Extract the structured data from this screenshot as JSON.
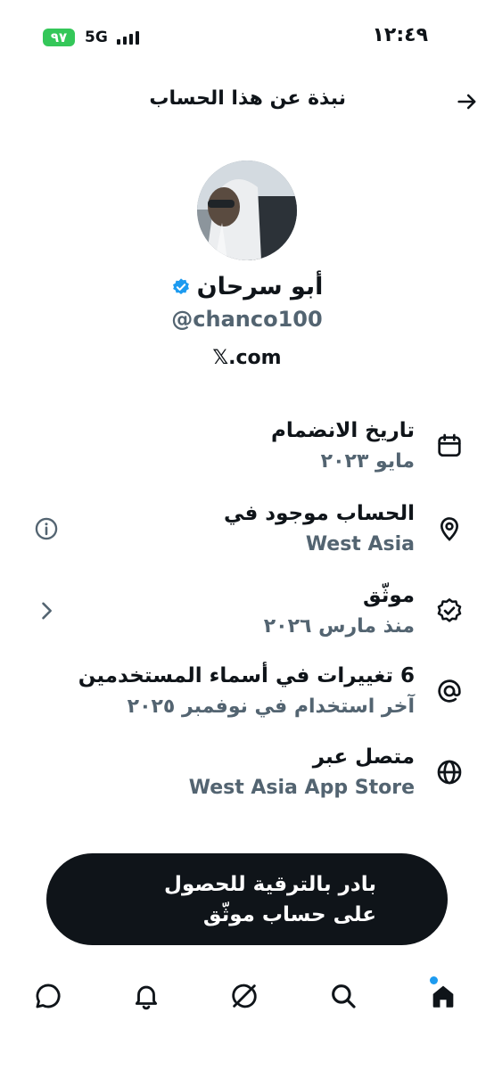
{
  "status_bar": {
    "time": "١٢:٤٩",
    "network": "5G",
    "battery": "٩٧"
  },
  "header": {
    "title": "نبذة عن هذا الحساب"
  },
  "profile": {
    "display_name": "أبو سرحان",
    "handle": "@chanco100",
    "website": "𝕏.com"
  },
  "info": [
    {
      "label": "تاريخ الانضمام",
      "value": "مايو ٢٠٢٣",
      "icon": "calendar-icon"
    },
    {
      "label": "الحساب موجود في",
      "value": "West Asia",
      "icon": "location-pin-icon"
    },
    {
      "label": "موثّق",
      "value": "منذ مارس ٢٠٢٦",
      "icon": "verified-outline-icon"
    },
    {
      "label": "6 تغييرات في أسماء المستخدمين",
      "value": "آخر استخدام في نوفمبر ٢٠٢٥",
      "icon": "at-sign-icon"
    },
    {
      "label": "متصل عبر",
      "value": "West Asia App Store",
      "icon": "globe-icon"
    }
  ],
  "cta": {
    "label": "بادر بالترقية للحصول على حساب موثّق"
  },
  "nav": [
    "home-icon",
    "search-icon",
    "grok-icon",
    "bell-icon",
    "messages-icon"
  ],
  "colors": {
    "accent": "#1d9bf0",
    "text_primary": "#0f1419",
    "text_secondary": "#536471",
    "battery": "#34c759"
  }
}
